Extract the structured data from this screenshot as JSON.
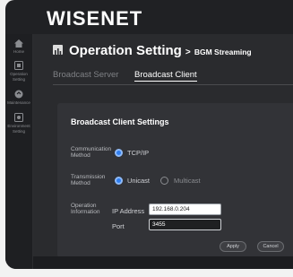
{
  "brand": {
    "logo_text": "WISENET"
  },
  "sidebar": {
    "items": [
      {
        "label": "Home",
        "icon": "home-icon"
      },
      {
        "label": "Operation Setting",
        "icon": "setting-icon"
      },
      {
        "label": "Maintenance",
        "icon": "maintenance-icon"
      },
      {
        "label": "Environment Setting",
        "icon": "environment-icon"
      }
    ]
  },
  "header": {
    "title": "Operation Setting",
    "separator": ">",
    "subtitle": "BGM Streaming"
  },
  "tabs": [
    {
      "label": "Broadcast Server",
      "active": false
    },
    {
      "label": "Broadcast Client",
      "active": true
    }
  ],
  "panel": {
    "title": "Broadcast Client Settings",
    "communication": {
      "label_line1": "Communication",
      "label_line2": "Method",
      "options": [
        {
          "label": "TCP/IP",
          "selected": true
        }
      ]
    },
    "transmission": {
      "label_line1": "Transmission",
      "label_line2": "Method",
      "options": [
        {
          "label": "Unicast",
          "selected": true
        },
        {
          "label": "Multicast",
          "selected": false
        }
      ]
    },
    "operation": {
      "label_line1": "Operation",
      "label_line2": "Information",
      "ip_label": "IP Address",
      "ip_value": "192.168.0.204",
      "port_label": "Port",
      "port_value": "3455"
    },
    "buttons": {
      "apply": "Apply",
      "cancel": "Cancel"
    }
  },
  "colors": {
    "background": "#202124",
    "panel": "#323337",
    "accent": "#2f7ef0",
    "text": "#ffffff"
  }
}
